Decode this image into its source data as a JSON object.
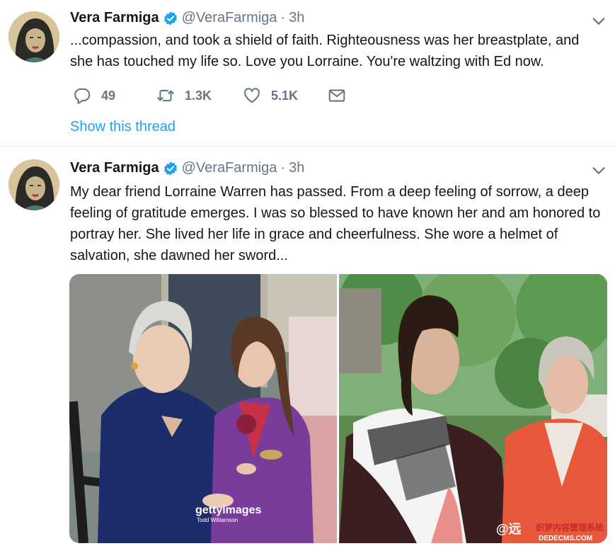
{
  "tweets": [
    {
      "name": "Vera Farmiga",
      "handle": "@VeraFarmiga",
      "separator": "·",
      "time": "3h",
      "text": "...compassion, and took a shield of faith. Righteousness was her breastplate, and she has touched my life so. Love you Lorraine. You're waltzing with Ed now.",
      "replies": "49",
      "retweets": "1.3K",
      "likes": "5.1K",
      "show_thread": "Show this thread"
    },
    {
      "name": "Vera Farmiga",
      "handle": "@VeraFarmiga",
      "separator": "·",
      "time": "3h",
      "text": "My dear friend Lorraine Warren has passed. From a deep feeling of sorrow, a deep feeling of gratitude emerges. I was so blessed to have known her and am honored to portray her. She lived her life in grace and cheerfulness. She wore a helmet of salvation, she dawned her sword...",
      "media": {
        "photo1_watermark": "gettyimages",
        "photo1_credit": "Todd Williamson",
        "overlay_watermark": "@远",
        "overlay_site_cn": "织梦内容管理系统",
        "overlay_site_en": "DEDECMS.COM"
      }
    }
  ],
  "colors": {
    "link": "#1da1f2",
    "muted": "#657786",
    "text": "#14171a",
    "divider": "#e6ecf0"
  },
  "icons": [
    "verified-badge-icon",
    "chevron-down-icon",
    "reply-icon",
    "retweet-icon",
    "like-icon",
    "share-icon"
  ]
}
